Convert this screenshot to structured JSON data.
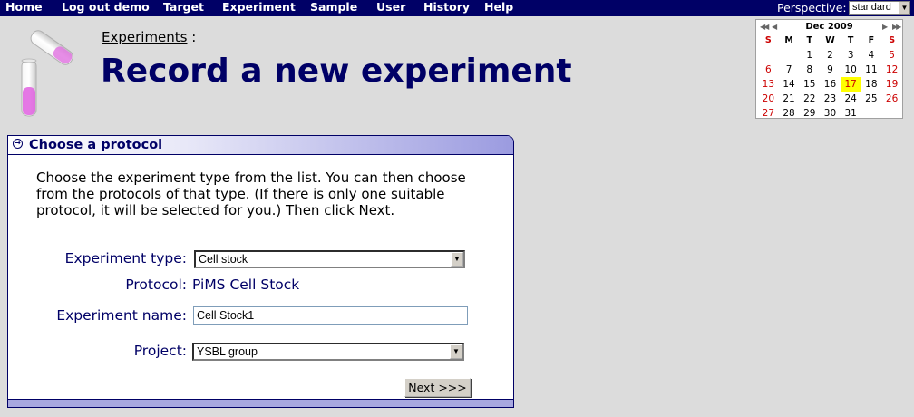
{
  "nav": {
    "items": [
      "Home",
      "Log out demo",
      "Target",
      "Experiment",
      "Sample",
      "User",
      "History",
      "Help"
    ],
    "perspective_label": "Perspective:",
    "perspective_value": "standard"
  },
  "header": {
    "breadcrumb": "Experiments",
    "breadcrumb_sep": " :",
    "title": "Record a new experiment"
  },
  "calendar": {
    "month": "Dec 2009",
    "dow": [
      "S",
      "M",
      "T",
      "W",
      "T",
      "F",
      "S"
    ],
    "weeks": [
      [
        "",
        "",
        "1",
        "2",
        "3",
        "4",
        "5"
      ],
      [
        "6",
        "7",
        "8",
        "9",
        "10",
        "11",
        "12"
      ],
      [
        "13",
        "14",
        "15",
        "16",
        "17",
        "18",
        "19"
      ],
      [
        "20",
        "21",
        "22",
        "23",
        "24",
        "25",
        "26"
      ],
      [
        "27",
        "28",
        "29",
        "30",
        "31",
        "",
        ""
      ]
    ],
    "today": "17",
    "colors": {
      "sunday": "#cc0000",
      "saturday": "#cc0000",
      "today_bg": "#ffff00"
    }
  },
  "panel": {
    "title": "Choose a protocol",
    "instructions": "Choose the experiment type from the list. You can then choose from the protocols of that type. (If there is only one suitable protocol, it will be selected for you.) Then click Next.",
    "experiment_type_label": "Experiment type:",
    "experiment_type_value": "Cell stock",
    "protocol_label": "Protocol:",
    "protocol_value": "PiMS Cell Stock",
    "experiment_name_label": "Experiment name:",
    "experiment_name_value": "Cell Stock1",
    "project_label": "Project:",
    "project_value": "YSBL group",
    "next_label": "Next >>>"
  },
  "colors": {
    "nav_bg": "#000066",
    "title": "#000066",
    "page_bg": "#dcdcdc"
  }
}
